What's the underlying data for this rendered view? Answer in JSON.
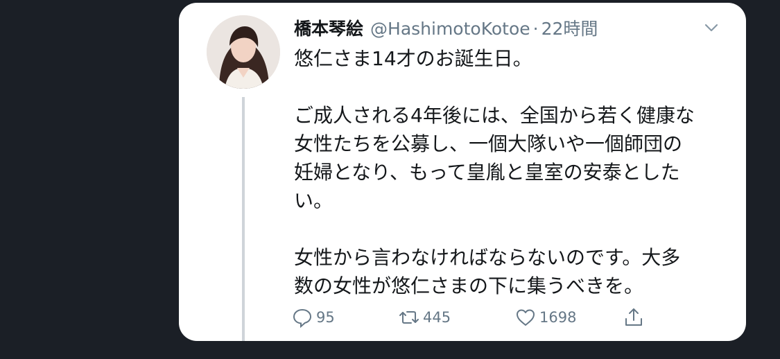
{
  "tweet": {
    "author_name": "橋本琴絵",
    "author_handle": "@HashimotoKotoe",
    "separator": "·",
    "timestamp": "22時間",
    "text": "悠仁さま14才のお誕生日。\n\nご成人される4年後には、全国から若く健康な\n女性たちを公募し、一個大隊いや一個師団の\n妊婦となり、もって皇胤と皇室の安泰とした\nい。\n\n女性から言わなければならないのです。大多\n数の女性が悠仁さまの下に集うべきを。",
    "replies": "95",
    "retweets": "445",
    "likes": "1698"
  },
  "icons": {
    "more": "chevron-down-icon",
    "reply": "comment-icon",
    "retweet": "retweet-icon",
    "like": "heart-icon",
    "share": "share-icon"
  },
  "colors": {
    "background": "#1b1f26",
    "card": "#ffffff",
    "text": "#14171a",
    "muted": "#657786"
  }
}
